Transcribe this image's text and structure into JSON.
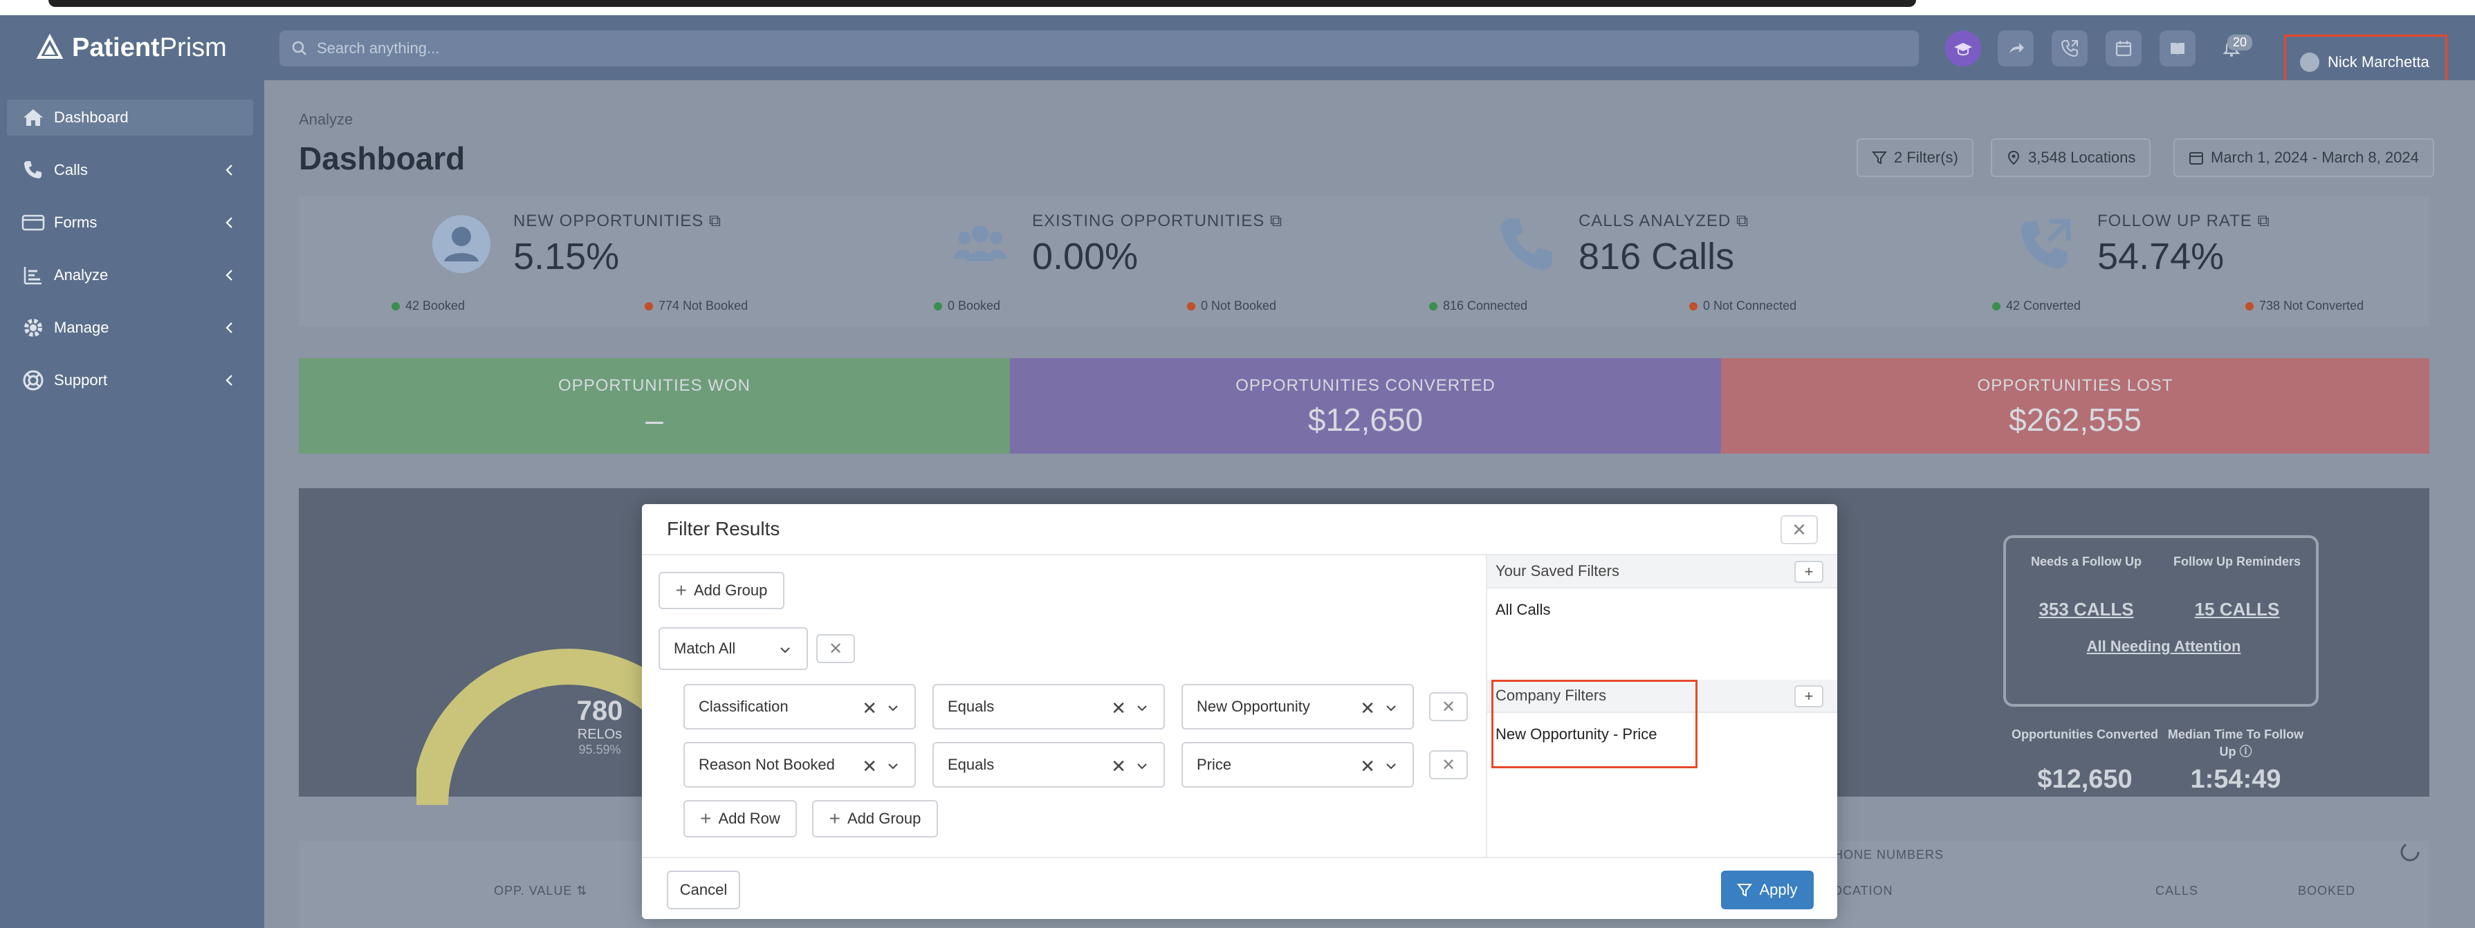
{
  "brand": {
    "name_bold": "Patient",
    "name_light": "Prism"
  },
  "search": {
    "placeholder": "Search anything..."
  },
  "notifications": {
    "count": "20"
  },
  "user": {
    "name": "Nick Marchetta"
  },
  "sidebar": {
    "items": [
      {
        "label": "Dashboard",
        "icon": "home-icon",
        "active": true
      },
      {
        "label": "Calls",
        "icon": "phone-icon"
      },
      {
        "label": "Forms",
        "icon": "forms-icon"
      },
      {
        "label": "Analyze",
        "icon": "analyze-icon"
      },
      {
        "label": "Manage",
        "icon": "gear-icon"
      },
      {
        "label": "Support",
        "icon": "lifebuoy-icon"
      }
    ]
  },
  "page": {
    "breadcrumb": "Analyze",
    "title": "Dashboard",
    "filters_label": "2 Filter(s)",
    "locations_label": "3,548 Locations",
    "date_range": "March 1, 2024 - March 8, 2024"
  },
  "stats": [
    {
      "label": "NEW OPPORTUNITIES",
      "value": "5.15%",
      "left_foot": "42 Booked",
      "right_foot": "774 Not Booked"
    },
    {
      "label": "EXISTING OPPORTUNITIES",
      "value": "0.00%",
      "left_foot": "0 Booked",
      "right_foot": "0 Not Booked"
    },
    {
      "label": "CALLS ANALYZED",
      "value": "816 Calls",
      "left_foot": "816 Connected",
      "right_foot": "0 Not Connected"
    },
    {
      "label": "FOLLOW UP RATE",
      "value": "54.74%",
      "left_foot": "42 Converted",
      "right_foot": "738 Not Converted"
    }
  ],
  "outcomes": [
    {
      "label": "OPPORTUNITIES WON",
      "value": "–",
      "color": "#6e9d7a"
    },
    {
      "label": "OPPORTUNITIES CONVERTED",
      "value": "$12,650",
      "color": "#7b6fa8"
    },
    {
      "label": "OPPORTUNITIES LOST",
      "value": "$262,555",
      "color": "#b36f74"
    }
  ],
  "gauge": {
    "number": "780",
    "sub": "RELOs",
    "pct": "95.59%"
  },
  "followup": {
    "needs_label": "Needs a Follow Up",
    "needs_value": "353 CALLS",
    "reminders_label": "Follow Up Reminders",
    "reminders_value": "15 CALLS",
    "all_label": "All Needing Attention",
    "opp_converted_label": "Opportunities Converted",
    "opp_converted_value": "$12,650",
    "median_label": "Median Time To Follow Up",
    "median_value": "1:54:49"
  },
  "bottom": {
    "opp_value": "OPP. VALUE",
    "phone_numbers": "PHONE NUMBERS",
    "location": "LOCATION",
    "calls": "CALLS",
    "booked": "BOOKED"
  },
  "modal": {
    "title": "Filter Results",
    "add_group": "Add Group",
    "match": "Match All",
    "rows": [
      {
        "field": "Classification",
        "op": "Equals",
        "value": "New Opportunity"
      },
      {
        "field": "Reason Not Booked",
        "op": "Equals",
        "value": "Price"
      }
    ],
    "add_row": "Add Row",
    "add_group_bottom": "Add Group",
    "saved_title": "Your Saved Filters",
    "saved_items": [
      "All Calls"
    ],
    "company_title": "Company Filters",
    "company_items": [
      "New Opportunity - Price"
    ],
    "cancel": "Cancel",
    "apply": "Apply"
  }
}
